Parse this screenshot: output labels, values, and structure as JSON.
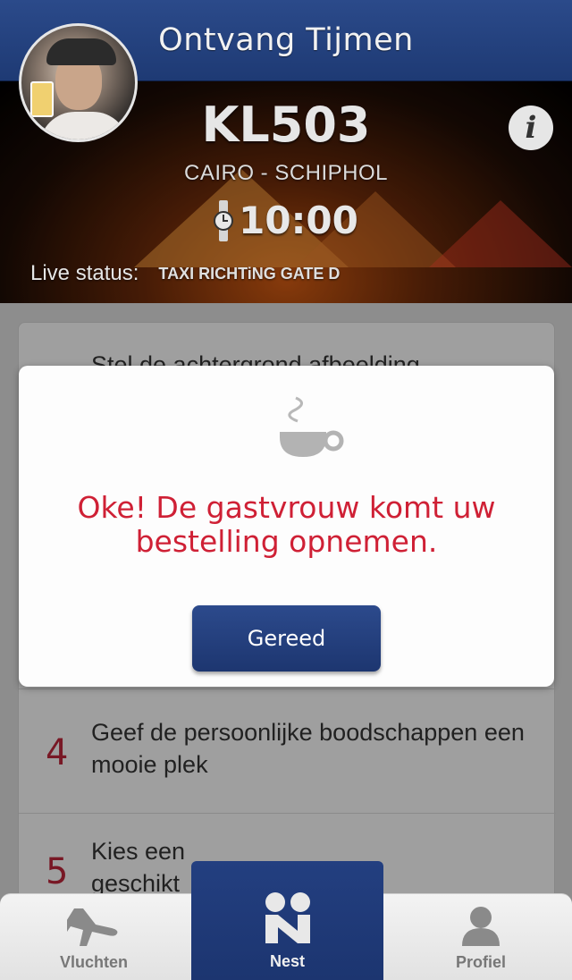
{
  "header": {
    "title": "Ontvang Tijmen"
  },
  "flight": {
    "number": "KL503",
    "route": "CAIRO - SCHIPHOL",
    "time": "10:00",
    "live_status_label": "Live status:",
    "live_status_value": "TAXI RICHTiNG GATE D"
  },
  "icons": {
    "info": "info-icon",
    "watch": "watch-icon",
    "cup": "coffee-cup-icon",
    "plane": "plane-icon",
    "nest": "nest-logo-icon",
    "profile": "profile-icon"
  },
  "background_item": {
    "text": "Stel de achtergrond afbeelding"
  },
  "steps": [
    {
      "num": "4",
      "text": "Geef de persoonlijke boodschappen een mooie plek"
    },
    {
      "num": "5",
      "text": "Kies een geschikt ontvangs"
    }
  ],
  "modal": {
    "message": "Oke! De gastvrouw komt uw bestelling opnemen.",
    "button": "Gereed"
  },
  "tabbar": {
    "vluchten": "Vluchten",
    "nest": "Nest",
    "profiel": "Profiel"
  },
  "colors": {
    "brand_blue": "#1e3a74",
    "accent_red": "#cf2035"
  }
}
